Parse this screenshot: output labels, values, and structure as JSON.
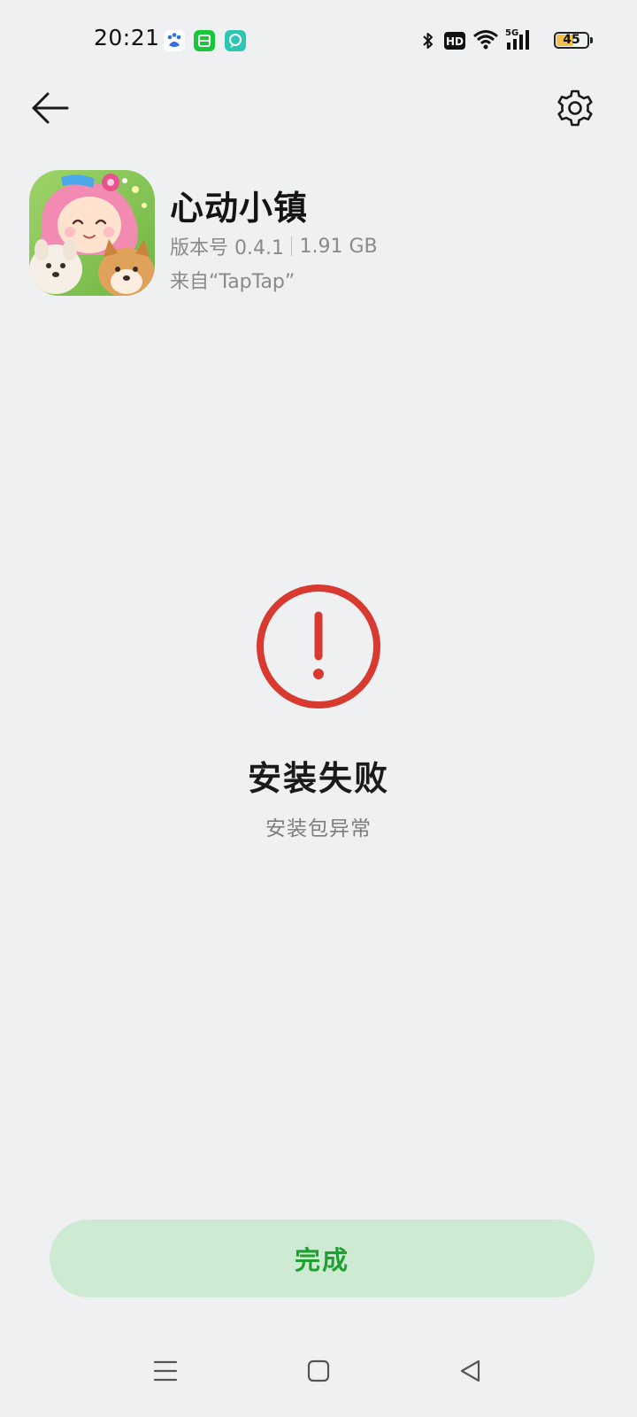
{
  "status_bar": {
    "time": "20:21",
    "notification_icons": [
      "baidu-icon",
      "green-app-icon",
      "teal-app-icon"
    ],
    "status_icons": [
      "bluetooth-icon",
      "hd-icon",
      "wifi-icon",
      "5g-signal-icon"
    ],
    "battery_level": "45"
  },
  "header": {
    "back_icon": "arrow-left-icon",
    "settings_icon": "gear-icon"
  },
  "app": {
    "name": "心动小镇",
    "version": "版本号 0.4.1",
    "size": "1.91 GB",
    "source": "来自“TapTap”"
  },
  "result": {
    "icon": "error-circle-icon",
    "title": "安装失败",
    "subtitle": "安装包异常"
  },
  "actions": {
    "done_label": "完成"
  },
  "nav_bar": {
    "items": [
      "menu-icon",
      "home-icon",
      "back-triangle-icon"
    ]
  },
  "colors": {
    "background": "#eff0f2",
    "error_red": "#d93a2f",
    "button_bg": "#cdebd3",
    "button_text": "#21a032",
    "battery_fill": "#f0c04a"
  }
}
